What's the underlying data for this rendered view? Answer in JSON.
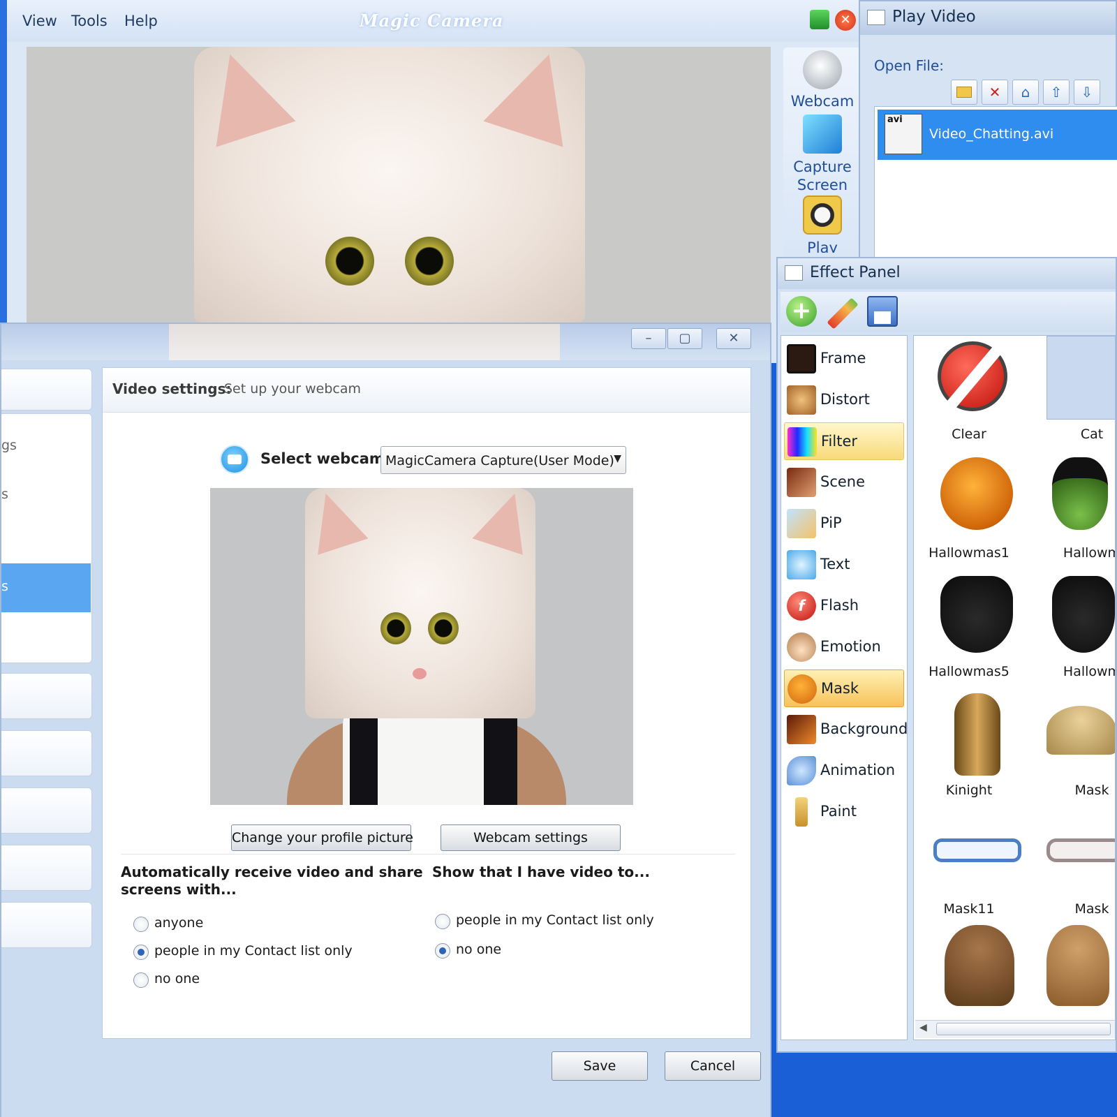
{
  "magic_camera": {
    "title": "Magic Camera",
    "menu": [
      "View",
      "Tools",
      "Help"
    ],
    "side_tools": [
      {
        "label": "Webcam",
        "icon": "webcam-icon"
      },
      {
        "label": "Capture",
        "label2": "Screen",
        "icon": "capture-screen-icon"
      },
      {
        "label": "Play",
        "icon": "film-reel-icon"
      }
    ]
  },
  "play_video": {
    "title": "Play Video",
    "open_file_label": "Open File:",
    "toolbar": [
      "folder-open-icon",
      "delete-icon",
      "save-icon",
      "move-up-icon",
      "move-down-icon"
    ],
    "files": [
      {
        "name": "Video_Chatting.avi",
        "badge": "avi",
        "selected": true
      }
    ]
  },
  "effect_panel": {
    "title": "Effect Panel",
    "toolbar": [
      "add-icon",
      "edit-pencil-icon",
      "save-disk-icon"
    ],
    "categories": [
      {
        "label": "Frame",
        "state": "normal"
      },
      {
        "label": "Distort",
        "state": "normal"
      },
      {
        "label": "Filter",
        "state": "hover"
      },
      {
        "label": "Scene",
        "state": "normal"
      },
      {
        "label": "PiP",
        "state": "normal"
      },
      {
        "label": "Text",
        "state": "normal"
      },
      {
        "label": "Flash",
        "state": "normal"
      },
      {
        "label": "Emotion",
        "state": "normal"
      },
      {
        "label": "Mask",
        "state": "selected"
      },
      {
        "label": "Background",
        "state": "normal"
      },
      {
        "label": "Animation",
        "state": "normal"
      },
      {
        "label": "Paint",
        "state": "normal"
      }
    ],
    "effects": [
      {
        "label": "Clear"
      },
      {
        "label": "Cat"
      },
      {
        "label": "Hallowmas1"
      },
      {
        "label": "Hallowm"
      },
      {
        "label": "Hallowmas5"
      },
      {
        "label": "Hallowm"
      },
      {
        "label": "Kinight"
      },
      {
        "label": "Mask"
      },
      {
        "label": "Mask11"
      },
      {
        "label": "Mask"
      },
      {
        "label": ""
      },
      {
        "label": ""
      }
    ]
  },
  "settings": {
    "window_buttons": [
      "–",
      "▢",
      "✕"
    ],
    "left_items": [
      "gs",
      "s",
      "s"
    ],
    "header_bold": "Video settings:",
    "header_rest": "Set up your webcam",
    "select_label": "Select webcam:",
    "select_value": "MagicCamera Capture(User Mode)",
    "change_picture_button": "Change your profile picture",
    "webcam_settings_button": "Webcam settings",
    "receive": {
      "title_line1": "Automatically receive video and share",
      "title_line2": "screens with...",
      "options": [
        {
          "label": "anyone",
          "checked": false
        },
        {
          "label": "people in my Contact list only",
          "checked": true
        },
        {
          "label": "no one",
          "checked": false
        }
      ]
    },
    "show_video": {
      "title": "Show that I have video to...",
      "options": [
        {
          "label": "people in my Contact list only",
          "checked": false
        },
        {
          "label": "no one",
          "checked": true
        }
      ]
    },
    "save_button": "Save",
    "cancel_button": "Cancel"
  },
  "colors": {
    "desktop_blue": "#1a5fd6",
    "selection_blue": "#2f8df0",
    "mask_highlight": "#f7c25a"
  }
}
